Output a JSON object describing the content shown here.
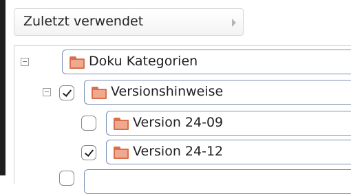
{
  "recent": {
    "label": "Zuletzt verwendet"
  },
  "tree": {
    "nodes": [
      {
        "label": "Doku Kategorien",
        "checked": false
      },
      {
        "label": "Versionshinweise",
        "checked": true
      },
      {
        "label": "Version 24-09",
        "checked": false
      },
      {
        "label": "Version 24-12",
        "checked": true
      }
    ]
  },
  "colors": {
    "folder_fill": "#f0a88f",
    "folder_border": "#d9704c",
    "node_border": "#7a8fb0"
  }
}
